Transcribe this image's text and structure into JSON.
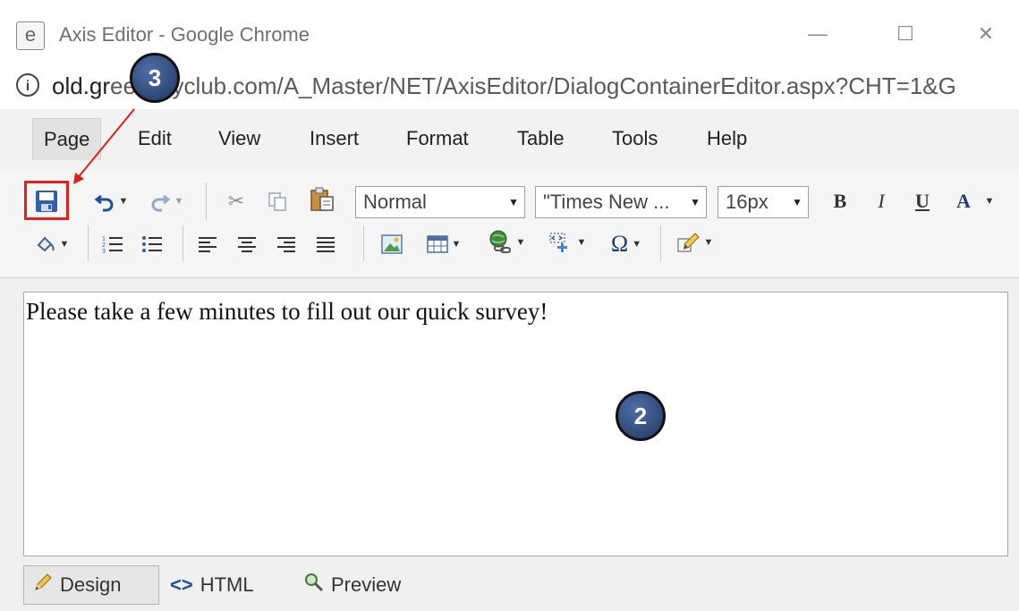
{
  "window": {
    "title": "Axis Editor - Google Chrome",
    "minimize": "—",
    "maximize": "☐",
    "close": "✕"
  },
  "address": {
    "url_host": "old.gr",
    "url_hidden": "eensy",
    "url_rest": "yclub.com/A_Master/NET/AxisEditor/DialogContainerEditor.aspx?CHT=1&G"
  },
  "menu": [
    "Page",
    "Edit",
    "View",
    "Insert",
    "Format",
    "Table",
    "Tools",
    "Help"
  ],
  "toolbar": {
    "paragraph_style": "Normal",
    "font_family": "\"Times New ...",
    "font_size": "16px",
    "bold": "B",
    "italic": "I",
    "underline": "U",
    "font_color": "A"
  },
  "editor": {
    "content": "Please take a few minutes to fill out our quick survey!"
  },
  "modes": {
    "design": "Design",
    "html": "HTML",
    "preview": "Preview"
  },
  "callouts": {
    "save": "3",
    "editor": "2"
  },
  "colors": {
    "highlight": "#e0201c",
    "callout": "#2e4576"
  }
}
